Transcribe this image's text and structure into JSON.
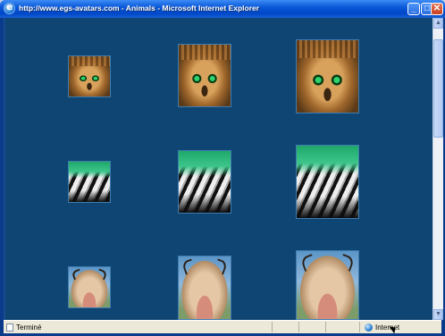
{
  "window": {
    "title": "http://www.egs-avatars.com - Animals - Microsoft Internet Explorer",
    "buttons": {
      "minimize": "_",
      "maximize": "□",
      "close": "✕"
    }
  },
  "gallery": {
    "background": "#0e4572",
    "rows": [
      {
        "animal": "owl",
        "sizes": [
          "small",
          "medium",
          "large"
        ]
      },
      {
        "animal": "tiger",
        "sizes": [
          "small",
          "medium",
          "large"
        ]
      },
      {
        "animal": "cow",
        "sizes": [
          "small",
          "medium",
          "large"
        ]
      }
    ]
  },
  "scrollbar": {
    "up_arrow": "▲",
    "down_arrow": "▼"
  },
  "statusbar": {
    "status": "Terminé",
    "zone": "Internet"
  },
  "icons": [
    "ie-icon",
    "minimize-icon",
    "maximize-icon",
    "close-icon",
    "document-icon",
    "globe-icon",
    "cursor-icon"
  ]
}
